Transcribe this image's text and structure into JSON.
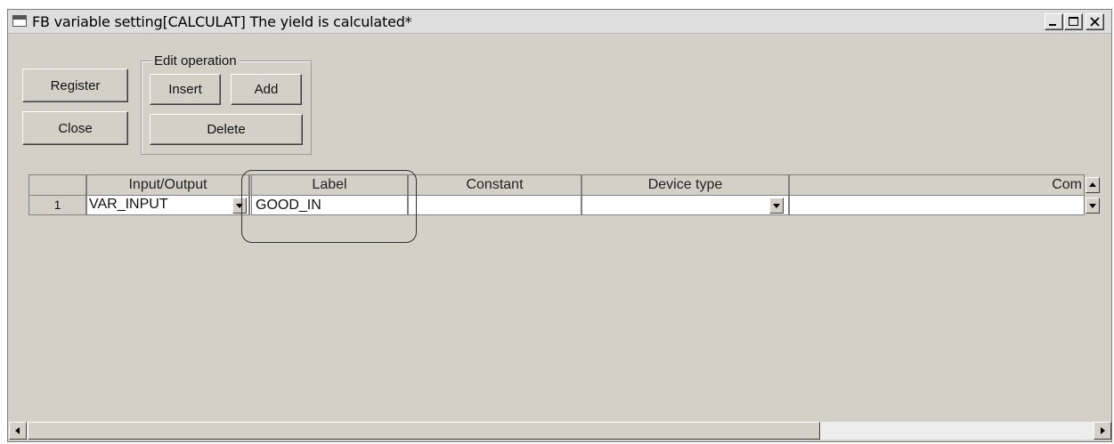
{
  "window": {
    "title": "FB variable setting[CALCULAT]  The yield is calculated*"
  },
  "buttons": {
    "register": "Register",
    "close": "Close"
  },
  "edit_operation": {
    "label": "Edit operation",
    "insert": "Insert",
    "add": "Add",
    "delete": "Delete"
  },
  "grid": {
    "columns": [
      "",
      "Input/Output",
      "Label",
      "Constant",
      "Device type",
      "Com"
    ],
    "rows": [
      {
        "number": "1",
        "input_output": "VAR_INPUT",
        "label": "GOOD_IN",
        "constant": "",
        "device_type": "",
        "comment": ""
      }
    ]
  },
  "icons": {
    "window": "window-icon",
    "minimize": "minimize-icon",
    "maximize": "maximize-icon",
    "close": "close-icon",
    "dropdown": "chevron-down-icon",
    "scroll_left": "arrow-left-icon",
    "scroll_right": "arrow-right-icon",
    "scroll_up": "arrow-up-icon",
    "scroll_down": "arrow-down-icon"
  }
}
